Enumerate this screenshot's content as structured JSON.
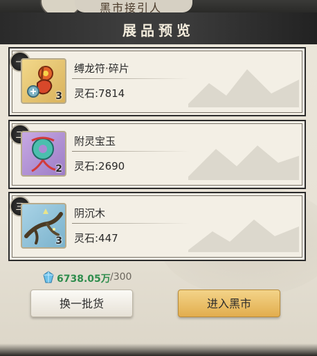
{
  "top_banner": {
    "text": "黑市接引人"
  },
  "dialog": {
    "title": "展品预览"
  },
  "items": [
    {
      "rank": "一",
      "name": "缚龙符·碎片",
      "price": "灵石:7814",
      "count": "3"
    },
    {
      "rank": "二",
      "name": "附灵宝玉",
      "price": "灵石:2690",
      "count": "2"
    },
    {
      "rank": "三",
      "name": "阴沉木",
      "price": "灵石:447",
      "count": "3"
    }
  ],
  "resource": {
    "value": "6738.05万",
    "cap": "/300",
    "icon": "spirit-stone-icon",
    "color": "#2f8d4d"
  },
  "buttons": {
    "swap": "换一批货",
    "enter": "进入黑市"
  },
  "colors": {
    "accent_gold": "#e2ad4e",
    "header_dark": "#2a2a2a",
    "panel_bg": "#ebe6da"
  }
}
